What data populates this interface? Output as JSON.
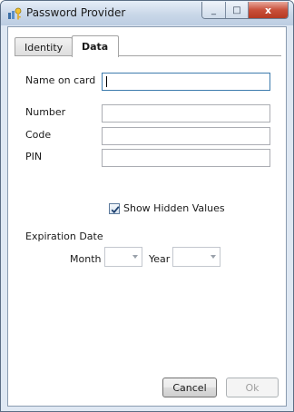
{
  "window": {
    "title": "Password Provider",
    "close_glyph": "x",
    "max_glyph": "□",
    "min_glyph": "_"
  },
  "tabs": [
    {
      "label": "Identity",
      "selected": false
    },
    {
      "label": "Data",
      "selected": true
    }
  ],
  "form": {
    "name_on_card": {
      "label": "Name on card",
      "value": ""
    },
    "number": {
      "label": "Number",
      "value": ""
    },
    "code": {
      "label": "Code",
      "value": ""
    },
    "pin": {
      "label": "PIN",
      "value": ""
    },
    "show_hidden": {
      "label": "Show Hidden Values",
      "checked": true
    },
    "expiration": {
      "label": "Expiration Date",
      "month_label": "Month",
      "month_value": "",
      "year_label": "Year",
      "year_value": ""
    }
  },
  "buttons": {
    "cancel": "Cancel",
    "ok": "Ok"
  },
  "colors": {
    "titlebar": "#c9d7e8",
    "close_button": "#c9503a",
    "focus_border": "#3d7bad"
  },
  "icons": {
    "app": "key-icon",
    "check": "checkmark-icon",
    "dropdown": "chevron-down-icon"
  }
}
